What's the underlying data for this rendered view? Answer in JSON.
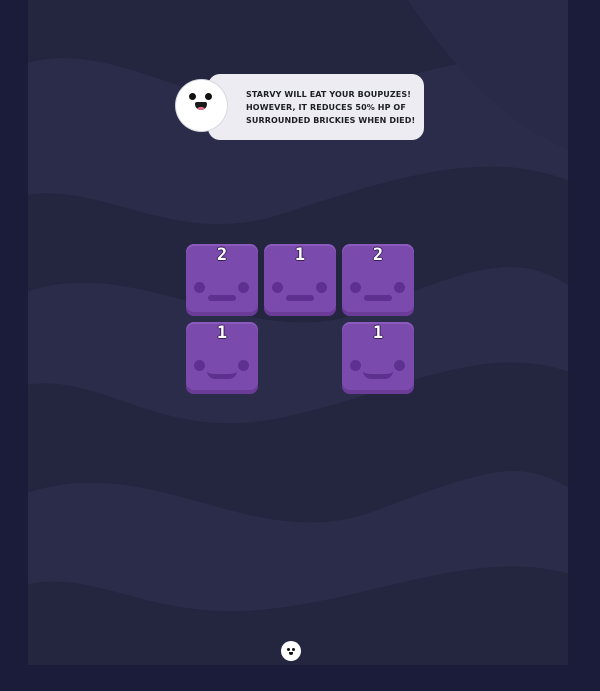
{
  "tutorial": {
    "speaker_icon": "starvy-face-icon",
    "lines": [
      "STARVY WILL EAT YOUR BOUPUZES!",
      "HOWEVER, IT REDUCES 50% HP OF",
      "SURROUNDED BRICKIES WHEN DIED!"
    ]
  },
  "bricks": [
    {
      "row": 0,
      "col": 0,
      "hp": "2",
      "mouth": "flat"
    },
    {
      "row": 0,
      "col": 1,
      "hp": "1",
      "mouth": "flat"
    },
    {
      "row": 0,
      "col": 2,
      "hp": "2",
      "mouth": "flat"
    },
    {
      "row": 1,
      "col": 0,
      "hp": "1",
      "mouth": "smile"
    },
    {
      "row": 1,
      "col": 2,
      "hp": "1",
      "mouth": "smile"
    }
  ],
  "ball": {
    "icon": "ball-face-icon"
  },
  "colors": {
    "frame": "#1a1c3a",
    "field": "#242640",
    "brick": "#7b4aad",
    "bubble": "#ececf2"
  }
}
